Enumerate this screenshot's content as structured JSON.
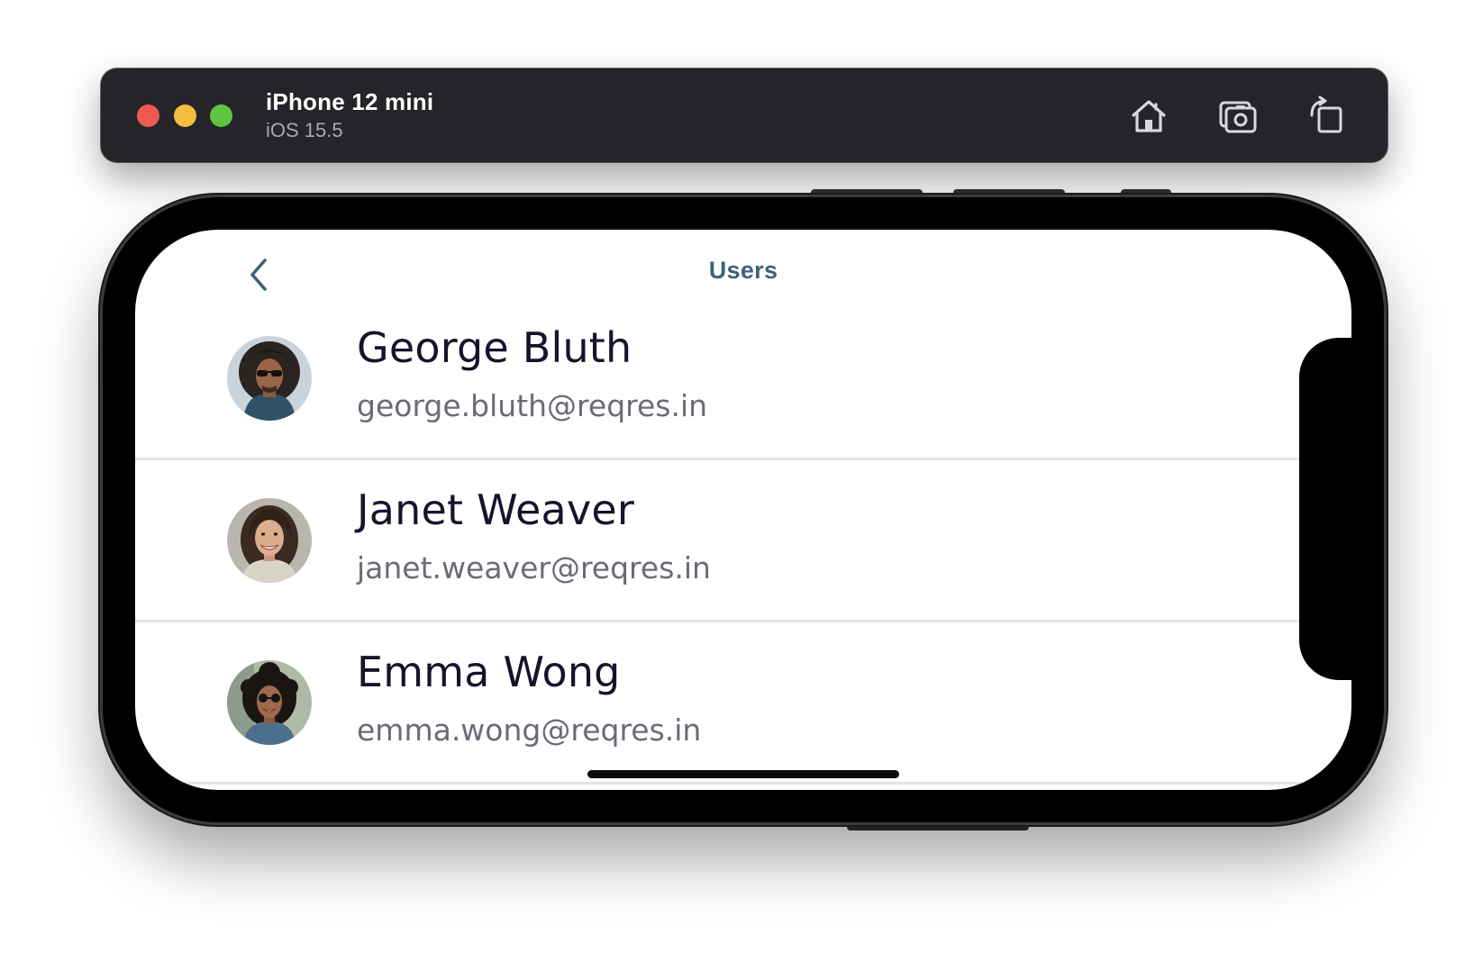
{
  "window": {
    "device_name": "iPhone 12 mini",
    "os_version": "iOS 15.5",
    "toolbar_icons": [
      "home-icon",
      "screenshot-icon",
      "rotate-icon"
    ]
  },
  "nav": {
    "title": "Users",
    "back_icon": "chevron-left-icon"
  },
  "users": [
    {
      "name": "George Bluth",
      "email": "george.bluth@reqres.in"
    },
    {
      "name": "Janet Weaver",
      "email": "janet.weaver@reqres.in"
    },
    {
      "name": "Emma Wong",
      "email": "emma.wong@reqres.in"
    }
  ],
  "colors": {
    "titlebar_bg": "#252428",
    "nav_title": "#3c6478",
    "name_text": "#14142b",
    "email_text": "#6b6b78",
    "divider": "#e4e4e7"
  }
}
